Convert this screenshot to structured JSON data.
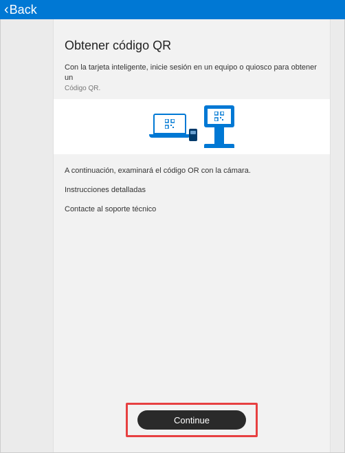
{
  "header": {
    "back_label": "Back"
  },
  "page": {
    "title": "Obtener código QR",
    "subtitle_line": "Con la tarjeta inteligente, inicie sesión en un equipo o quiosco para obtener un",
    "subtitle_small": "Código QR.",
    "scan_line": "A continuación, examinará el código OR con la cámara.",
    "instructions_link": "Instrucciones detalladas",
    "support_link": "Contacte al soporte técnico"
  },
  "footer": {
    "continue_label": "Continue"
  },
  "colors": {
    "accent": "#0078d4",
    "highlight_border": "#e74041"
  }
}
